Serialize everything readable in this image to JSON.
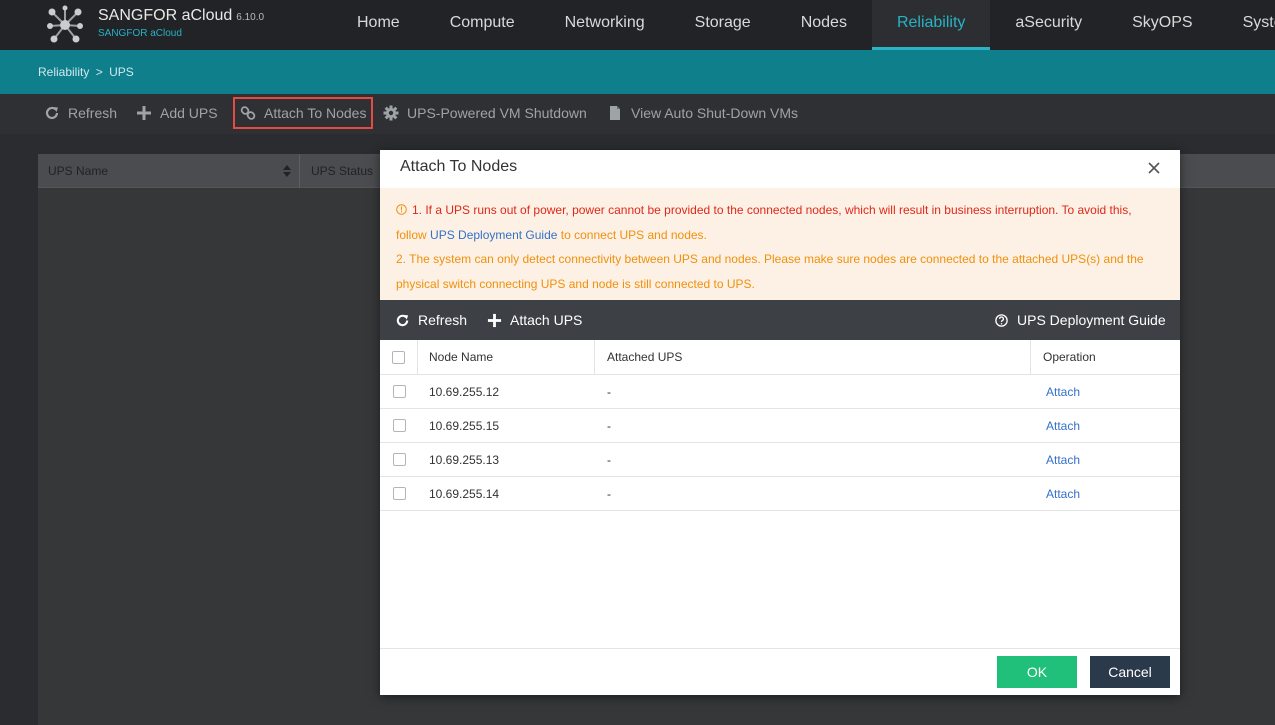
{
  "brand": {
    "title": "SANGFOR aCloud",
    "version": "6.10.0",
    "subtitle": "SANGFOR aCloud",
    "logo_icon": "molecule-network-icon"
  },
  "nav": {
    "items": [
      "Home",
      "Compute",
      "Networking",
      "Storage",
      "Nodes",
      "Reliability",
      "aSecurity",
      "SkyOPS",
      "System"
    ],
    "active": "Reliability"
  },
  "breadcrumb": {
    "parent": "Reliability",
    "separator": ">",
    "current": "UPS"
  },
  "toolbar": {
    "refresh": "Refresh",
    "add_ups": "Add UPS",
    "attach_to_nodes": "Attach To Nodes",
    "vm_shutdown": "UPS-Powered VM Shutdown",
    "view_auto_shutdown": "View Auto Shut-Down VMs"
  },
  "background_table": {
    "columns": [
      "UPS Name",
      "UPS Status"
    ]
  },
  "modal": {
    "title": "Attach To Nodes",
    "warning": {
      "line1_red": "1. If a UPS runs out of power, power cannot be provided to the connected nodes, which will result in business interruption. To avoid this,",
      "line1_follow": "follow",
      "line1_link": "UPS Deployment Guide",
      "line1_tail": "to connect UPS and nodes.",
      "line2": "2. The system can only detect connectivity between UPS and nodes. Please make sure nodes are connected to the attached UPS(s) and the physical switch connecting UPS and node is still connected to UPS."
    },
    "toolbar": {
      "refresh": "Refresh",
      "attach_ups": "Attach UPS",
      "guide": "UPS Deployment Guide"
    },
    "table": {
      "headers": {
        "node_name": "Node Name",
        "attached_ups": "Attached UPS",
        "operation": "Operation"
      },
      "rows": [
        {
          "node": "10.69.255.12",
          "ups": "-",
          "action": "Attach"
        },
        {
          "node": "10.69.255.15",
          "ups": "-",
          "action": "Attach"
        },
        {
          "node": "10.69.255.13",
          "ups": "-",
          "action": "Attach"
        },
        {
          "node": "10.69.255.14",
          "ups": "-",
          "action": "Attach"
        }
      ]
    },
    "footer": {
      "ok": "OK",
      "cancel": "Cancel"
    }
  },
  "colors": {
    "accent": "#27b4c4",
    "band": "#0f7f8c",
    "ok": "#21c07a",
    "cancel": "#2b3a4a",
    "warning_red": "#e0281a",
    "warning_orange": "#f0900c",
    "link": "#3371c9"
  }
}
